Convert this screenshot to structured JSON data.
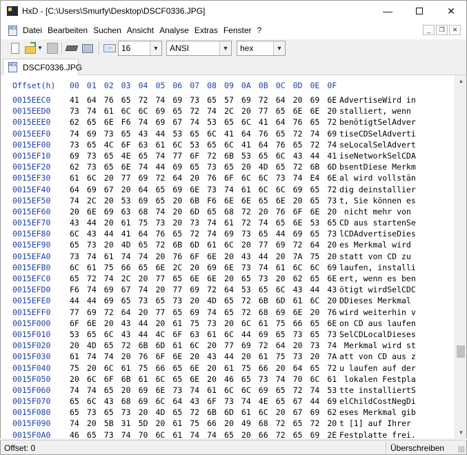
{
  "window": {
    "title": "HxD - [C:\\Users\\Smurfy\\Desktop\\DSCF0336.JPG]",
    "minimize_glyph": "—",
    "close_glyph": "✕"
  },
  "menu": {
    "items": [
      "Datei",
      "Bearbeiten",
      "Suchen",
      "Ansicht",
      "Analyse",
      "Extras",
      "Fenster",
      "?"
    ],
    "mdi_minimize": "_",
    "mdi_restore": "❐",
    "mdi_close": "✕"
  },
  "toolbar": {
    "bytes_per_row": "16",
    "charset": "ANSI",
    "offset_base": "hex",
    "dropdown_glyph": "▼"
  },
  "tabs": [
    {
      "label": "DSCF0336.JPG",
      "active": true
    }
  ],
  "hex_view": {
    "offset_header": "Offset(h)",
    "column_headers": [
      "00",
      "01",
      "02",
      "03",
      "04",
      "05",
      "06",
      "07",
      "08",
      "09",
      "0A",
      "0B",
      "0C",
      "0D",
      "0E",
      "0F"
    ],
    "rows": [
      {
        "offset": "0015EEC0",
        "bytes": [
          "41",
          "64",
          "76",
          "65",
          "72",
          "74",
          "69",
          "73",
          "65",
          "57",
          "69",
          "72",
          "64",
          "20",
          "69",
          "6E"
        ],
        "text": "AdvertiseWird in"
      },
      {
        "offset": "0015EED0",
        "bytes": [
          "73",
          "74",
          "61",
          "6C",
          "6C",
          "69",
          "65",
          "72",
          "74",
          "2C",
          "20",
          "77",
          "65",
          "6E",
          "6E",
          "20"
        ],
        "text": "stalliert, wenn "
      },
      {
        "offset": "0015EEE0",
        "bytes": [
          "62",
          "65",
          "6E",
          "F6",
          "74",
          "69",
          "67",
          "74",
          "53",
          "65",
          "6C",
          "41",
          "64",
          "76",
          "65",
          "72"
        ],
        "text": "benötigtSelAdver"
      },
      {
        "offset": "0015EEF0",
        "bytes": [
          "74",
          "69",
          "73",
          "65",
          "43",
          "44",
          "53",
          "65",
          "6C",
          "41",
          "64",
          "76",
          "65",
          "72",
          "74",
          "69"
        ],
        "text": "tiseCDSelAdverti"
      },
      {
        "offset": "0015EF00",
        "bytes": [
          "73",
          "65",
          "4C",
          "6F",
          "63",
          "61",
          "6C",
          "53",
          "65",
          "6C",
          "41",
          "64",
          "76",
          "65",
          "72",
          "74"
        ],
        "text": "seLocalSelAdvert"
      },
      {
        "offset": "0015EF10",
        "bytes": [
          "69",
          "73",
          "65",
          "4E",
          "65",
          "74",
          "77",
          "6F",
          "72",
          "6B",
          "53",
          "65",
          "6C",
          "43",
          "44",
          "41"
        ],
        "text": "iseNetworkSelCDA"
      },
      {
        "offset": "0015EF20",
        "bytes": [
          "62",
          "73",
          "65",
          "6E",
          "74",
          "44",
          "69",
          "65",
          "73",
          "65",
          "20",
          "4D",
          "65",
          "72",
          "6B",
          "6D"
        ],
        "text": "bsentDiese Merkm"
      },
      {
        "offset": "0015EF30",
        "bytes": [
          "61",
          "6C",
          "20",
          "77",
          "69",
          "72",
          "64",
          "20",
          "76",
          "6F",
          "6C",
          "6C",
          "73",
          "74",
          "E4",
          "6E"
        ],
        "text": "al wird vollstän"
      },
      {
        "offset": "0015EF40",
        "bytes": [
          "64",
          "69",
          "67",
          "20",
          "64",
          "65",
          "69",
          "6E",
          "73",
          "74",
          "61",
          "6C",
          "6C",
          "69",
          "65",
          "72"
        ],
        "text": "dig deinstallier"
      },
      {
        "offset": "0015EF50",
        "bytes": [
          "74",
          "2C",
          "20",
          "53",
          "69",
          "65",
          "20",
          "6B",
          "F6",
          "6E",
          "6E",
          "65",
          "6E",
          "20",
          "65",
          "73"
        ],
        "text": "t, Sie können es"
      },
      {
        "offset": "0015EF60",
        "bytes": [
          "20",
          "6E",
          "69",
          "63",
          "68",
          "74",
          "20",
          "6D",
          "65",
          "68",
          "72",
          "20",
          "76",
          "6F",
          "6E",
          "20"
        ],
        "text": " nicht mehr von "
      },
      {
        "offset": "0015EF70",
        "bytes": [
          "43",
          "44",
          "20",
          "61",
          "75",
          "73",
          "20",
          "73",
          "74",
          "61",
          "72",
          "74",
          "65",
          "6E",
          "53",
          "65"
        ],
        "text": "CD aus startenSe"
      },
      {
        "offset": "0015EF80",
        "bytes": [
          "6C",
          "43",
          "44",
          "41",
          "64",
          "76",
          "65",
          "72",
          "74",
          "69",
          "73",
          "65",
          "44",
          "69",
          "65",
          "73"
        ],
        "text": "lCDAdvertiseDies"
      },
      {
        "offset": "0015EF90",
        "bytes": [
          "65",
          "73",
          "20",
          "4D",
          "65",
          "72",
          "6B",
          "6D",
          "61",
          "6C",
          "20",
          "77",
          "69",
          "72",
          "64",
          "20"
        ],
        "text": "es Merkmal wird "
      },
      {
        "offset": "0015EFA0",
        "bytes": [
          "73",
          "74",
          "61",
          "74",
          "74",
          "20",
          "76",
          "6F",
          "6E",
          "20",
          "43",
          "44",
          "20",
          "7A",
          "75",
          "20"
        ],
        "text": "statt von CD zu "
      },
      {
        "offset": "0015EFB0",
        "bytes": [
          "6C",
          "61",
          "75",
          "66",
          "65",
          "6E",
          "2C",
          "20",
          "69",
          "6E",
          "73",
          "74",
          "61",
          "6C",
          "6C",
          "69"
        ],
        "text": "laufen, installi"
      },
      {
        "offset": "0015EFC0",
        "bytes": [
          "65",
          "72",
          "74",
          "2C",
          "20",
          "77",
          "65",
          "6E",
          "6E",
          "20",
          "65",
          "73",
          "20",
          "62",
          "65",
          "6E"
        ],
        "text": "ert, wenn es ben"
      },
      {
        "offset": "0015EFD0",
        "bytes": [
          "F6",
          "74",
          "69",
          "67",
          "74",
          "20",
          "77",
          "69",
          "72",
          "64",
          "53",
          "65",
          "6C",
          "43",
          "44",
          "43"
        ],
        "text": "ötigt wirdSelCDC"
      },
      {
        "offset": "0015EFE0",
        "bytes": [
          "44",
          "44",
          "69",
          "65",
          "73",
          "65",
          "73",
          "20",
          "4D",
          "65",
          "72",
          "6B",
          "6D",
          "61",
          "6C",
          "20"
        ],
        "text": "DDieses Merkmal "
      },
      {
        "offset": "0015EFF0",
        "bytes": [
          "77",
          "69",
          "72",
          "64",
          "20",
          "77",
          "65",
          "69",
          "74",
          "65",
          "72",
          "68",
          "69",
          "6E",
          "20",
          "76"
        ],
        "text": "wird weiterhin v"
      },
      {
        "offset": "0015F000",
        "bytes": [
          "6F",
          "6E",
          "20",
          "43",
          "44",
          "20",
          "61",
          "75",
          "73",
          "20",
          "6C",
          "61",
          "75",
          "66",
          "65",
          "6E"
        ],
        "text": "on CD aus laufen"
      },
      {
        "offset": "0015F010",
        "bytes": [
          "53",
          "65",
          "6C",
          "43",
          "44",
          "4C",
          "6F",
          "63",
          "61",
          "6C",
          "44",
          "69",
          "65",
          "73",
          "65",
          "73"
        ],
        "text": "SelCDLocalDieses"
      },
      {
        "offset": "0015F020",
        "bytes": [
          "20",
          "4D",
          "65",
          "72",
          "6B",
          "6D",
          "61",
          "6C",
          "20",
          "77",
          "69",
          "72",
          "64",
          "20",
          "73",
          "74"
        ],
        "text": " Merkmal wird st"
      },
      {
        "offset": "0015F030",
        "bytes": [
          "61",
          "74",
          "74",
          "20",
          "76",
          "6F",
          "6E",
          "20",
          "43",
          "44",
          "20",
          "61",
          "75",
          "73",
          "20",
          "7A"
        ],
        "text": "att von CD aus z"
      },
      {
        "offset": "0015F040",
        "bytes": [
          "75",
          "20",
          "6C",
          "61",
          "75",
          "66",
          "65",
          "6E",
          "20",
          "61",
          "75",
          "66",
          "20",
          "64",
          "65",
          "72"
        ],
        "text": "u laufen auf der"
      },
      {
        "offset": "0015F050",
        "bytes": [
          "20",
          "6C",
          "6F",
          "6B",
          "61",
          "6C",
          "65",
          "6E",
          "20",
          "46",
          "65",
          "73",
          "74",
          "70",
          "6C",
          "61"
        ],
        "text": " lokalen Festpla"
      },
      {
        "offset": "0015F060",
        "bytes": [
          "74",
          "74",
          "65",
          "20",
          "69",
          "6E",
          "73",
          "74",
          "61",
          "6C",
          "6C",
          "69",
          "65",
          "72",
          "74",
          "53"
        ],
        "text": "tte installiertS"
      },
      {
        "offset": "0015F070",
        "bytes": [
          "65",
          "6C",
          "43",
          "68",
          "69",
          "6C",
          "64",
          "43",
          "6F",
          "73",
          "74",
          "4E",
          "65",
          "67",
          "44",
          "69"
        ],
        "text": "elChildCostNegDi"
      },
      {
        "offset": "0015F080",
        "bytes": [
          "65",
          "73",
          "65",
          "73",
          "20",
          "4D",
          "65",
          "72",
          "6B",
          "6D",
          "61",
          "6C",
          "20",
          "67",
          "69",
          "62"
        ],
        "text": "eses Merkmal gib"
      },
      {
        "offset": "0015F090",
        "bytes": [
          "74",
          "20",
          "5B",
          "31",
          "5D",
          "20",
          "61",
          "75",
          "66",
          "20",
          "49",
          "68",
          "72",
          "65",
          "72",
          "20"
        ],
        "text": "t [1] auf Ihrer "
      },
      {
        "offset": "0015F0A0",
        "bytes": [
          "46",
          "65",
          "73",
          "74",
          "70",
          "6C",
          "61",
          "74",
          "74",
          "65",
          "20",
          "66",
          "72",
          "65",
          "69",
          "2E"
        ],
        "text": "Festplatte frei."
      }
    ],
    "scroll_position": 0.79,
    "scroll_up_glyph": "▲",
    "scroll_down_glyph": "▼"
  },
  "status": {
    "offset": "Offset: 0",
    "mode": "Überschreiben"
  }
}
